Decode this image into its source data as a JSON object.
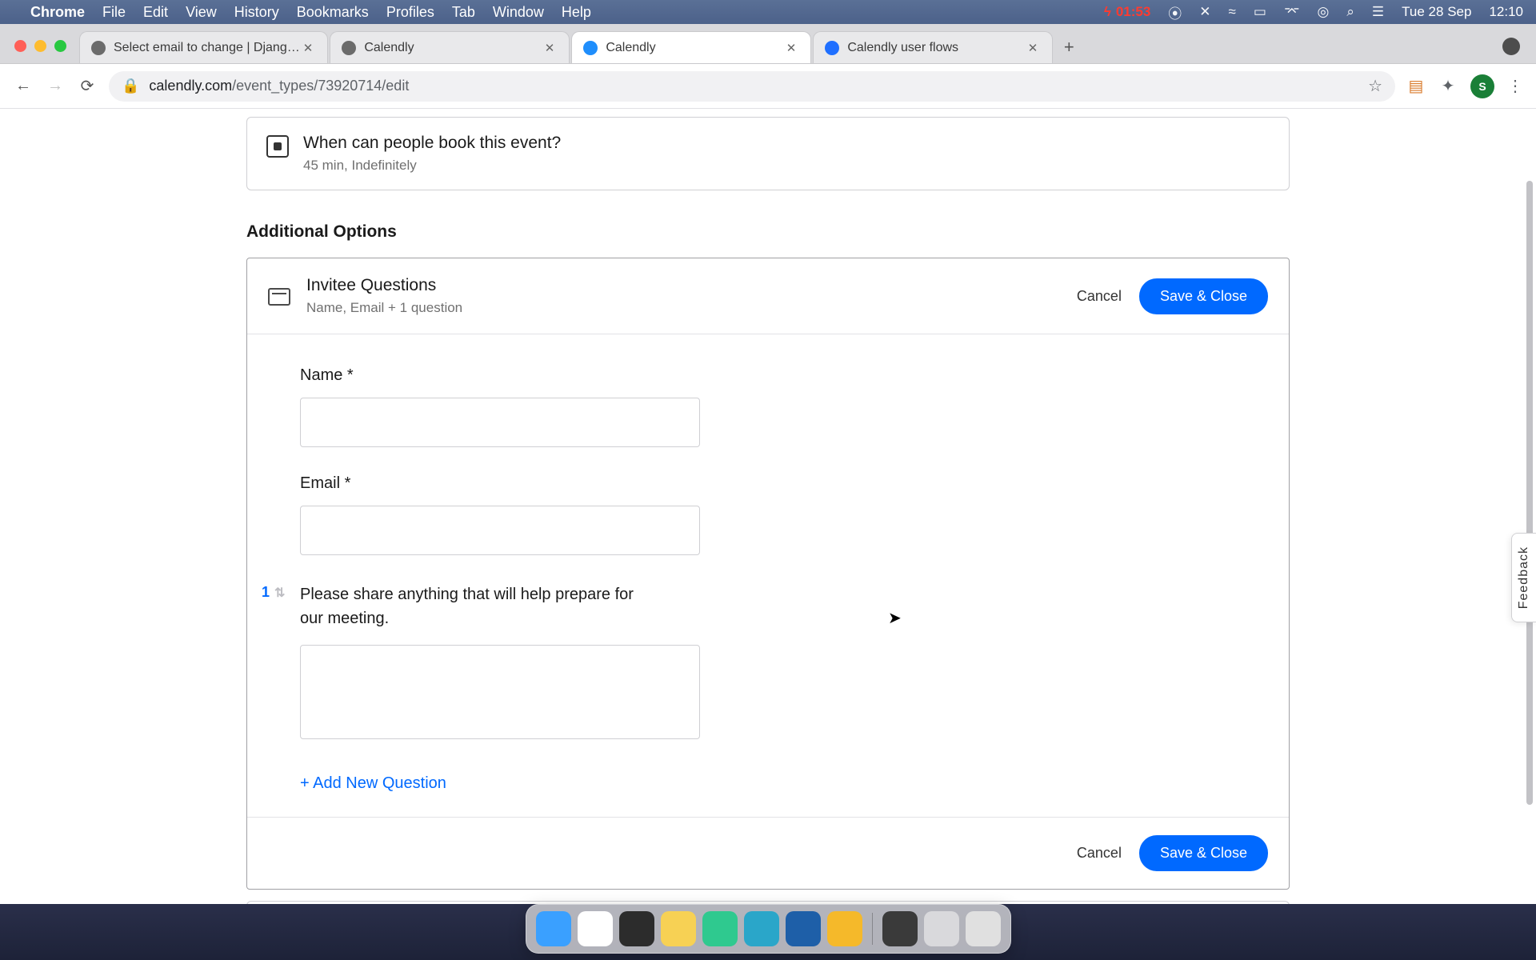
{
  "menubar": {
    "app_name": "Chrome",
    "menus": [
      "File",
      "Edit",
      "View",
      "History",
      "Bookmarks",
      "Profiles",
      "Tab",
      "Window",
      "Help"
    ],
    "battery_status": "01:53",
    "date": "Tue 28 Sep",
    "time": "12:10"
  },
  "tabs": {
    "t0": {
      "title": "Select email to change | Djang…"
    },
    "t1": {
      "title": "Calendly"
    },
    "t2": {
      "title": "Calendly"
    },
    "t3": {
      "title": "Calendly user flows"
    }
  },
  "address": {
    "domain": "calendly.com",
    "path": "/event_types/73920714/edit",
    "avatar_initial": "S"
  },
  "booking": {
    "title": "When can people book this event?",
    "sub": "45 min, Indefinitely"
  },
  "section_heading": "Additional Options",
  "invitee": {
    "title": "Invitee Questions",
    "sub": "Name, Email + 1 question",
    "cancel": "Cancel",
    "save": "Save & Close",
    "fields": {
      "name_label": "Name *",
      "email_label": "Email *",
      "q1_num": "1",
      "q1_label": "Please share anything that will help prepare for our meeting.",
      "add_question": "+ Add New Question"
    },
    "footer": {
      "cancel": "Cancel",
      "save": "Save & Close"
    }
  },
  "feedback_label": "Feedback",
  "dock_colors": [
    "#3aa0ff",
    "#ffffff",
    "#2c2c2c",
    "#f7d154",
    "#2fc98f",
    "#2aa6c9",
    "#1e5fa8",
    "#f5b92a",
    "#3a3a3a",
    "#d9d9dc",
    "#e0e0e0"
  ]
}
